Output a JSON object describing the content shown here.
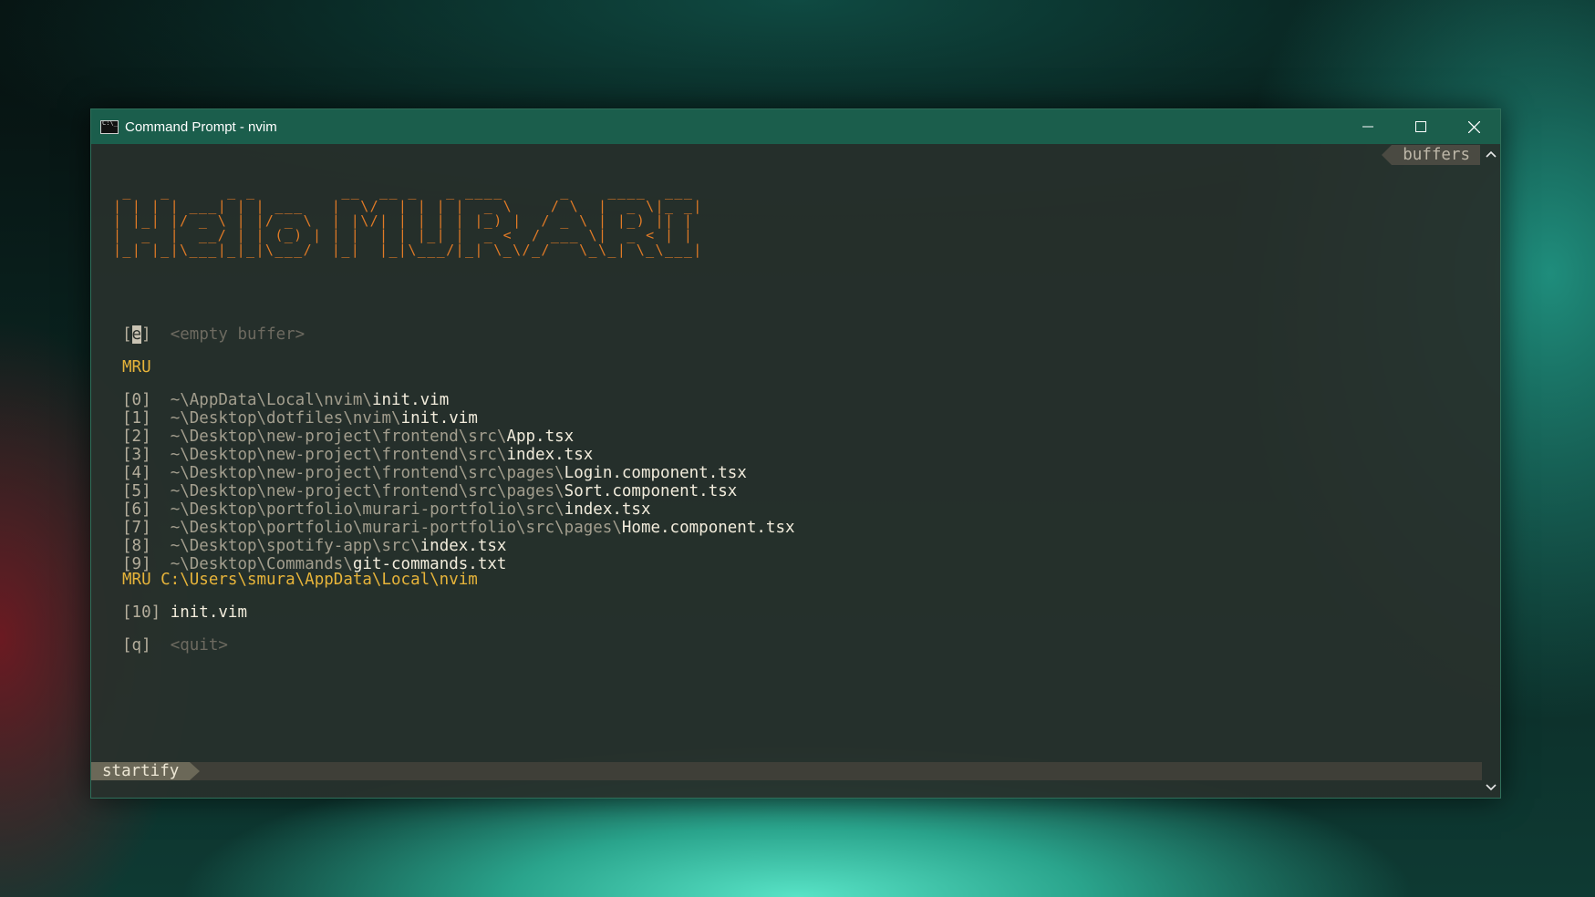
{
  "window": {
    "title": "Command Prompt - nvim"
  },
  "tabline": {
    "buffers_label": "buffers"
  },
  "banner": {
    "ascii_lines": [
      " _   _      _ _         __  __ _   _ ____      _    ____  ___ ",
      "| | | | ___| | | ___   |  \\/  | | | |  _ \\    / \\  |  _ \\|_ _|",
      "| |_| |/ _ \\ | |/ _ \\  | |\\/| | | | | |_) |  / _ \\ | |_) || | ",
      "|  _  |  __/ | | (_) | | |  | | |_| |  _ <  / ___ \\|  _ < | | ",
      "|_| |_|\\___|_|_|\\___/  |_|  |_|\\___/|_| \\_\\/_/   \\_\\_| \\_\\___|"
    ]
  },
  "startify": {
    "empty": {
      "bracket_open": "[",
      "key": "e",
      "bracket_close": "]",
      "label": "<empty buffer>"
    },
    "mru_header": "MRU",
    "mru": [
      {
        "key": "[0]",
        "dir": "~\\AppData\\Local\\nvim\\",
        "file": "init.vim"
      },
      {
        "key": "[1]",
        "dir": "~\\Desktop\\dotfiles\\nvim\\",
        "file": "init.vim"
      },
      {
        "key": "[2]",
        "dir": "~\\Desktop\\new-project\\frontend\\src\\",
        "file": "App.tsx"
      },
      {
        "key": "[3]",
        "dir": "~\\Desktop\\new-project\\frontend\\src\\",
        "file": "index.tsx"
      },
      {
        "key": "[4]",
        "dir": "~\\Desktop\\new-project\\frontend\\src\\pages\\",
        "file": "Login.component.tsx"
      },
      {
        "key": "[5]",
        "dir": "~\\Desktop\\new-project\\frontend\\src\\pages\\",
        "file": "Sort.component.tsx"
      },
      {
        "key": "[6]",
        "dir": "~\\Desktop\\portfolio\\murari-portfolio\\src\\",
        "file": "index.tsx"
      },
      {
        "key": "[7]",
        "dir": "~\\Desktop\\portfolio\\murari-portfolio\\src\\pages\\",
        "file": "Home.component.tsx"
      },
      {
        "key": "[8]",
        "dir": "~\\Desktop\\spotify-app\\src\\",
        "file": "index.tsx"
      },
      {
        "key": "[9]",
        "dir": "~\\Desktop\\Commands\\",
        "file": "git-commands.txt"
      }
    ],
    "cwd_header": "MRU C:\\Users\\smura\\AppData\\Local\\nvim",
    "cwd": [
      {
        "key": "[10]",
        "file": "init.vim"
      }
    ],
    "quit": {
      "key": "[q]",
      "label": "<quit>"
    }
  },
  "statusline": {
    "mode": "startify"
  }
}
